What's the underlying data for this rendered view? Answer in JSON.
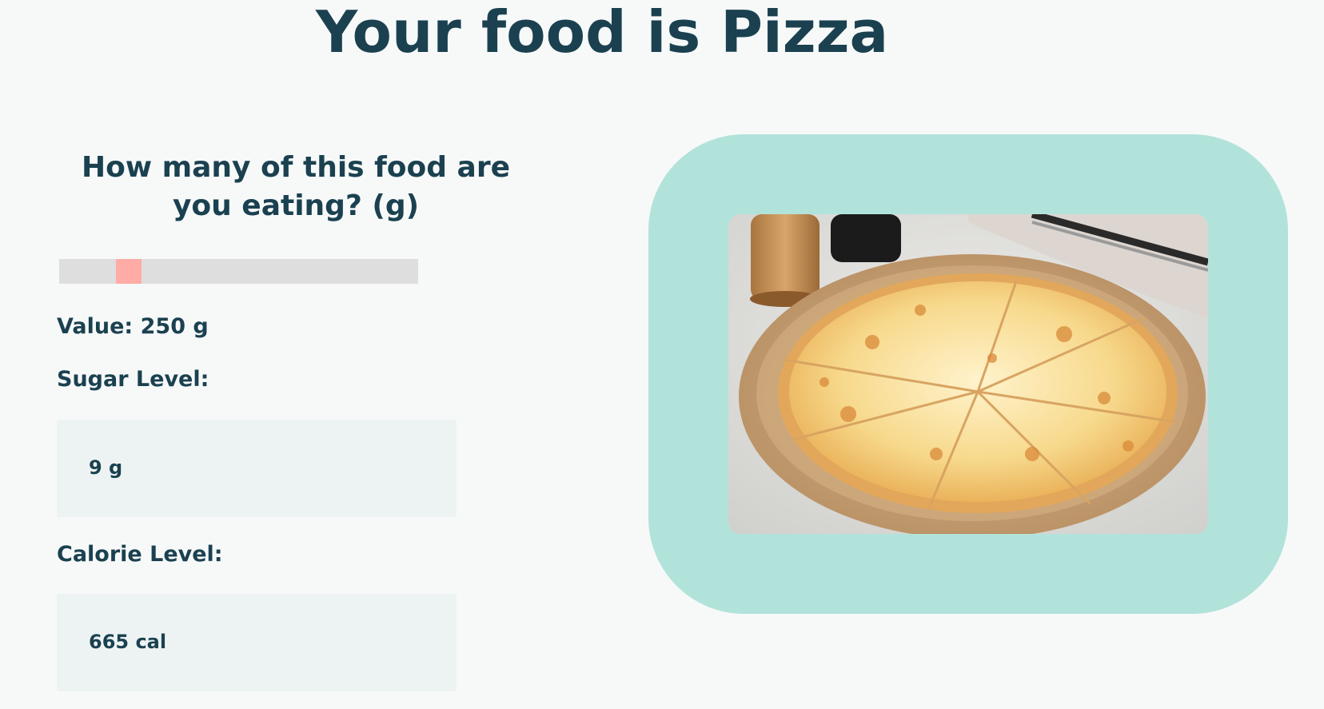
{
  "header": {
    "title": "Your food is Pizza"
  },
  "question": {
    "text": "How many of this food are you eating? (g)"
  },
  "slider": {
    "value": 250,
    "unit": "g",
    "position_fraction": 0.17
  },
  "value_label": "Value: 250 g",
  "sugar": {
    "label": "Sugar Level:",
    "value": "9 g"
  },
  "calorie": {
    "label": "Calorie Level:",
    "value": "665 cal"
  },
  "image": {
    "subject": "pizza-photo"
  },
  "colors": {
    "title_text": "#1b4150",
    "background": "#f7f9f9",
    "frame": "#b2e3db",
    "slider_track": "#dedede",
    "slider_thumb": "#ffaba6",
    "metric_box": "#edf3f3"
  }
}
